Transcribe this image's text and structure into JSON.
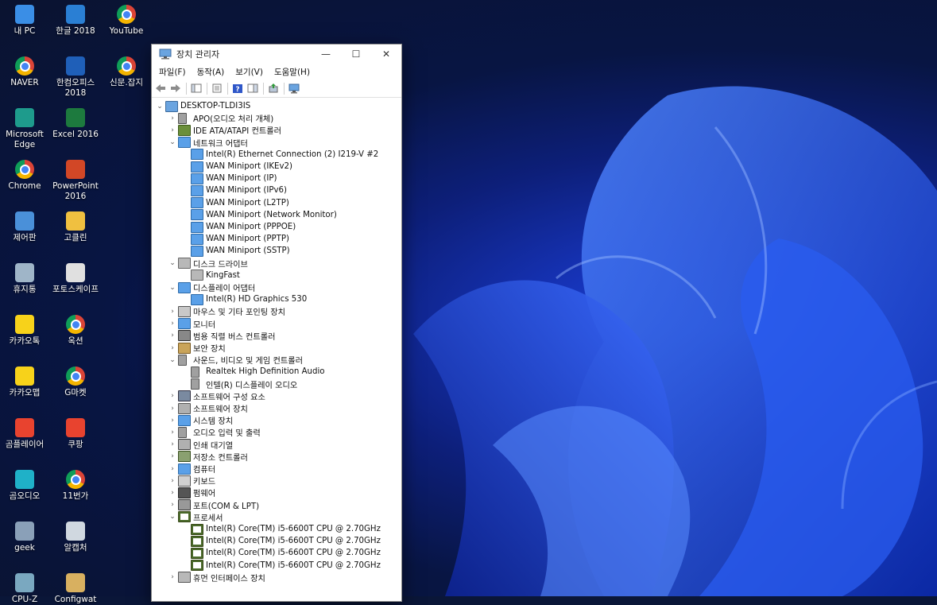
{
  "desktop": {
    "icons": [
      {
        "label": "내 PC",
        "icon": "monitor-icon"
      },
      {
        "label": "한글 2018",
        "icon": "hangul-icon"
      },
      {
        "label": "YouTube",
        "icon": "chrome-icon"
      },
      {
        "label": "NAVER",
        "icon": "chrome-icon"
      },
      {
        "label": "한컴오피스 2018",
        "icon": "hancom-icon"
      },
      {
        "label": "신문.잡지",
        "icon": "chrome-icon"
      },
      {
        "label": "Microsoft Edge",
        "icon": "edge-icon"
      },
      {
        "label": "Excel 2016",
        "icon": "excel-icon"
      },
      {
        "label": "Chrome",
        "icon": "chrome-icon"
      },
      {
        "label": "PowerPoint 2016",
        "icon": "powerpoint-icon"
      },
      {
        "label": "제어판",
        "icon": "control-panel-icon"
      },
      {
        "label": "고클린",
        "icon": "goclean-icon"
      },
      {
        "label": "휴지통",
        "icon": "recycle-bin-icon"
      },
      {
        "label": "포토스케이프",
        "icon": "photoscape-icon"
      },
      {
        "label": "카카오톡",
        "icon": "kakaotalk-icon"
      },
      {
        "label": "옥션",
        "icon": "chrome-icon"
      },
      {
        "label": "카카오맵",
        "icon": "kakaomap-icon"
      },
      {
        "label": "G마켓",
        "icon": "chrome-icon"
      },
      {
        "label": "곰플레이어",
        "icon": "gomplayer-icon"
      },
      {
        "label": "쿠팡",
        "icon": "coupang-icon"
      },
      {
        "label": "곰오디오",
        "icon": "gomaudio-icon"
      },
      {
        "label": "11번가",
        "icon": "chrome-icon"
      },
      {
        "label": "geek",
        "icon": "geek-icon"
      },
      {
        "label": "알캡처",
        "icon": "alcapture-icon"
      },
      {
        "label": "CPU-Z",
        "icon": "cpuz-icon"
      },
      {
        "label": "Configwat",
        "icon": "config-icon"
      }
    ]
  },
  "window": {
    "title": "장치 관리자",
    "controls": {
      "minimize": "—",
      "maximize": "☐",
      "close": "✕"
    },
    "menu": [
      "파일(F)",
      "동작(A)",
      "보기(V)",
      "도움말(H)"
    ],
    "tree": [
      {
        "level": 0,
        "toggle": "v",
        "icon": "computer-icon",
        "label": "DESKTOP-TLDI3IS"
      },
      {
        "level": 1,
        "toggle": ">",
        "icon": "speaker-icon",
        "label": "APO(오디오 처리 개체)"
      },
      {
        "level": 1,
        "toggle": ">",
        "icon": "ide-icon",
        "label": "IDE ATA/ATAPI 컨트롤러"
      },
      {
        "level": 1,
        "toggle": "v",
        "icon": "network-icon",
        "label": "네트워크 어댑터"
      },
      {
        "level": 2,
        "toggle": "",
        "icon": "network-icon",
        "label": "Intel(R) Ethernet Connection (2) I219-V #2"
      },
      {
        "level": 2,
        "toggle": "",
        "icon": "network-icon",
        "label": "WAN Miniport (IKEv2)"
      },
      {
        "level": 2,
        "toggle": "",
        "icon": "network-icon",
        "label": "WAN Miniport (IP)"
      },
      {
        "level": 2,
        "toggle": "",
        "icon": "network-icon",
        "label": "WAN Miniport (IPv6)"
      },
      {
        "level": 2,
        "toggle": "",
        "icon": "network-icon",
        "label": "WAN Miniport (L2TP)"
      },
      {
        "level": 2,
        "toggle": "",
        "icon": "network-icon",
        "label": "WAN Miniport (Network Monitor)"
      },
      {
        "level": 2,
        "toggle": "",
        "icon": "network-icon",
        "label": "WAN Miniport (PPPOE)"
      },
      {
        "level": 2,
        "toggle": "",
        "icon": "network-icon",
        "label": "WAN Miniport (PPTP)"
      },
      {
        "level": 2,
        "toggle": "",
        "icon": "network-icon",
        "label": "WAN Miniport (SSTP)"
      },
      {
        "level": 1,
        "toggle": "v",
        "icon": "disk-icon",
        "label": "디스크 드라이브"
      },
      {
        "level": 2,
        "toggle": "",
        "icon": "disk-icon",
        "label": "KingFast"
      },
      {
        "level": 1,
        "toggle": "v",
        "icon": "display-icon",
        "label": "디스플레이 어댑터"
      },
      {
        "level": 2,
        "toggle": "",
        "icon": "display-icon",
        "label": "Intel(R) HD Graphics 530"
      },
      {
        "level": 1,
        "toggle": ">",
        "icon": "mouse-icon",
        "label": "마우스 및 기타 포인팅 장치"
      },
      {
        "level": 1,
        "toggle": ">",
        "icon": "monitor-icon",
        "label": "모니터"
      },
      {
        "level": 1,
        "toggle": ">",
        "icon": "usb-icon",
        "label": "범용 직렬 버스 컨트롤러"
      },
      {
        "level": 1,
        "toggle": ">",
        "icon": "security-icon",
        "label": "보안 장치"
      },
      {
        "level": 1,
        "toggle": "v",
        "icon": "speaker-icon",
        "label": "사운드, 비디오 및 게임 컨트롤러"
      },
      {
        "level": 2,
        "toggle": "",
        "icon": "speaker-icon",
        "label": "Realtek High Definition Audio"
      },
      {
        "level": 2,
        "toggle": "",
        "icon": "speaker-icon",
        "label": "인텔(R) 디스플레이 오디오"
      },
      {
        "level": 1,
        "toggle": ">",
        "icon": "software-component-icon",
        "label": "소프트웨어 구성 요소"
      },
      {
        "level": 1,
        "toggle": ">",
        "icon": "software-device-icon",
        "label": "소프트웨어 장치"
      },
      {
        "level": 1,
        "toggle": ">",
        "icon": "system-icon",
        "label": "시스템 장치"
      },
      {
        "level": 1,
        "toggle": ">",
        "icon": "speaker-icon",
        "label": "오디오 입력 및 출력"
      },
      {
        "level": 1,
        "toggle": ">",
        "icon": "printer-icon",
        "label": "인쇄 대기열"
      },
      {
        "level": 1,
        "toggle": ">",
        "icon": "storage-controller-icon",
        "label": "저장소 컨트롤러"
      },
      {
        "level": 1,
        "toggle": ">",
        "icon": "monitor-icon",
        "label": "컴퓨터"
      },
      {
        "level": 1,
        "toggle": ">",
        "icon": "keyboard-icon",
        "label": "키보드"
      },
      {
        "level": 1,
        "toggle": ">",
        "icon": "firmware-icon",
        "label": "펌웨어"
      },
      {
        "level": 1,
        "toggle": ">",
        "icon": "port-icon",
        "label": "포트(COM & LPT)"
      },
      {
        "level": 1,
        "toggle": "v",
        "icon": "processor-icon",
        "label": "프로세서"
      },
      {
        "level": 2,
        "toggle": "",
        "icon": "processor-icon",
        "label": "Intel(R) Core(TM) i5-6600T CPU @ 2.70GHz"
      },
      {
        "level": 2,
        "toggle": "",
        "icon": "processor-icon",
        "label": "Intel(R) Core(TM) i5-6600T CPU @ 2.70GHz"
      },
      {
        "level": 2,
        "toggle": "",
        "icon": "processor-icon",
        "label": "Intel(R) Core(TM) i5-6600T CPU @ 2.70GHz"
      },
      {
        "level": 2,
        "toggle": "",
        "icon": "processor-icon",
        "label": "Intel(R) Core(TM) i5-6600T CPU @ 2.70GHz"
      },
      {
        "level": 1,
        "toggle": ">",
        "icon": "hid-icon",
        "label": "휴먼 인터페이스 장치"
      }
    ]
  },
  "colors": {
    "accent": "#1a73e8",
    "wallpaper_blue": "#1f4fe0"
  }
}
